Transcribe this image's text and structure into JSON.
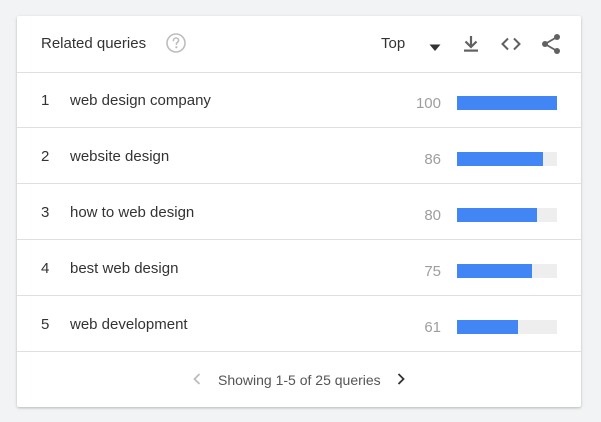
{
  "widget": {
    "title": "Related queries",
    "help_icon": "help-circle-icon",
    "sort_select": {
      "selected": "Top",
      "icon": "caret-down-icon"
    },
    "tools": {
      "download_icon": "download-icon",
      "embed_icon": "code-embed-icon",
      "share_icon": "share-icon"
    }
  },
  "rows": [
    {
      "rank": "1",
      "query": "web design company",
      "value": "100",
      "level": 100
    },
    {
      "rank": "2",
      "query": "website design",
      "value": "86",
      "level": 86
    },
    {
      "rank": "3",
      "query": "how to web design",
      "value": "80",
      "level": 80
    },
    {
      "rank": "4",
      "query": "best web design",
      "value": "75",
      "level": 75
    },
    {
      "rank": "5",
      "query": "web development",
      "value": "61",
      "level": 61
    }
  ],
  "pagination": {
    "text": "Showing 1-5 of 25 queries",
    "prev_icon": "chevron-left-icon",
    "next_icon": "chevron-right-icon"
  },
  "colors": {
    "bar": "#4285f4",
    "bar_track": "#eeeeee",
    "disabled": "#bdbdbd",
    "icon": "#616161"
  }
}
